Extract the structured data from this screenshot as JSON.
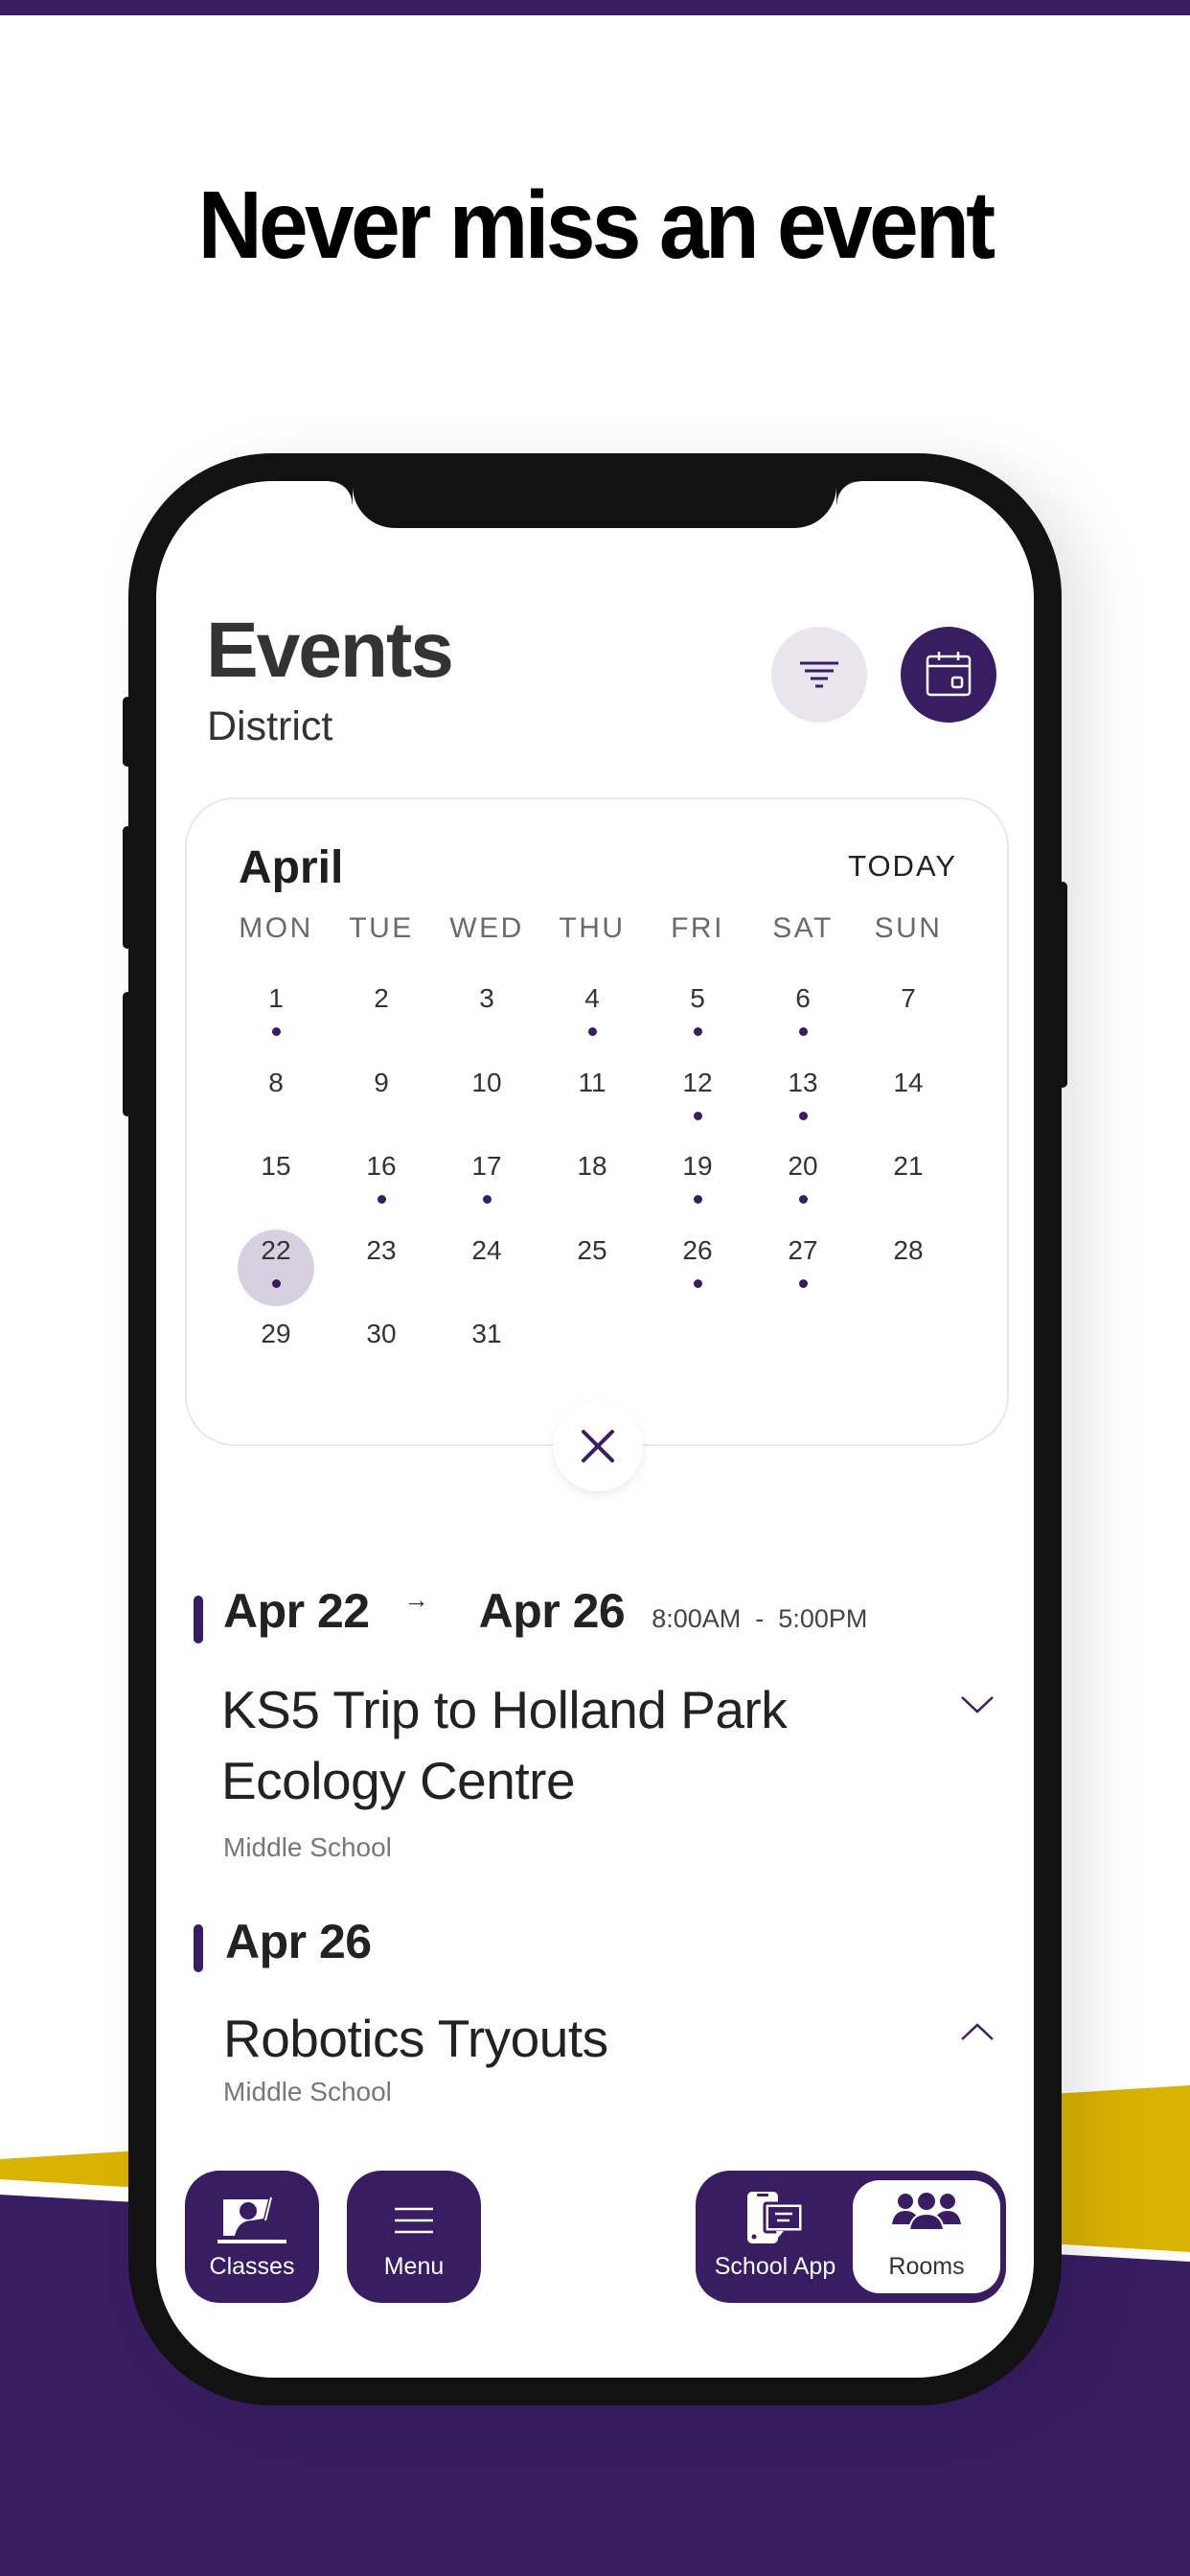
{
  "colors": {
    "brand_purple": "#381d63",
    "brand_yellow": "#d9b302",
    "selected_day_bg": "#d7d0e1",
    "filter_bg": "#e9e5ef"
  },
  "headline": "Never miss an event",
  "header": {
    "title": "Events",
    "subtitle": "District",
    "filter_icon": "filter-icon",
    "calendar_icon": "calendar-icon"
  },
  "calendar": {
    "month": "April",
    "today_label": "TODAY",
    "weekdays": [
      "MON",
      "TUE",
      "WED",
      "THU",
      "FRI",
      "SAT",
      "SUN"
    ],
    "selected_day": 22,
    "days": [
      {
        "n": "1",
        "dot": true
      },
      {
        "n": "2",
        "dot": false
      },
      {
        "n": "3",
        "dot": false
      },
      {
        "n": "4",
        "dot": true
      },
      {
        "n": "5",
        "dot": true
      },
      {
        "n": "6",
        "dot": true
      },
      {
        "n": "7",
        "dot": false
      },
      {
        "n": "8",
        "dot": false
      },
      {
        "n": "9",
        "dot": false
      },
      {
        "n": "10",
        "dot": false
      },
      {
        "n": "11",
        "dot": false
      },
      {
        "n": "12",
        "dot": true
      },
      {
        "n": "13",
        "dot": true
      },
      {
        "n": "14",
        "dot": false
      },
      {
        "n": "15",
        "dot": false
      },
      {
        "n": "16",
        "dot": true
      },
      {
        "n": "17",
        "dot": true
      },
      {
        "n": "18",
        "dot": false
      },
      {
        "n": "19",
        "dot": true
      },
      {
        "n": "20",
        "dot": true
      },
      {
        "n": "21",
        "dot": false
      },
      {
        "n": "22",
        "dot": true
      },
      {
        "n": "23",
        "dot": false
      },
      {
        "n": "24",
        "dot": false
      },
      {
        "n": "25",
        "dot": false
      },
      {
        "n": "26",
        "dot": true
      },
      {
        "n": "27",
        "dot": true
      },
      {
        "n": "28",
        "dot": false
      },
      {
        "n": "29",
        "dot": false
      },
      {
        "n": "30",
        "dot": false
      },
      {
        "n": "31",
        "dot": false
      }
    ],
    "collapse_icon": "close-icon"
  },
  "events": [
    {
      "start_date": "Apr 22",
      "arrow": "→",
      "end_date": "Apr 26",
      "time": "8:00AM  -  5:00PM",
      "title": "KS5 Trip to Holland Park Ecology Centre",
      "org": "Middle School",
      "expanded": false
    },
    {
      "start_date": "Apr 26",
      "title": "Robotics Tryouts",
      "org": "Middle School",
      "expanded": true
    }
  ],
  "bottom_nav": {
    "classes": "Classes",
    "menu": "Menu",
    "school_app": "School App",
    "rooms": "Rooms",
    "active": "Rooms"
  }
}
